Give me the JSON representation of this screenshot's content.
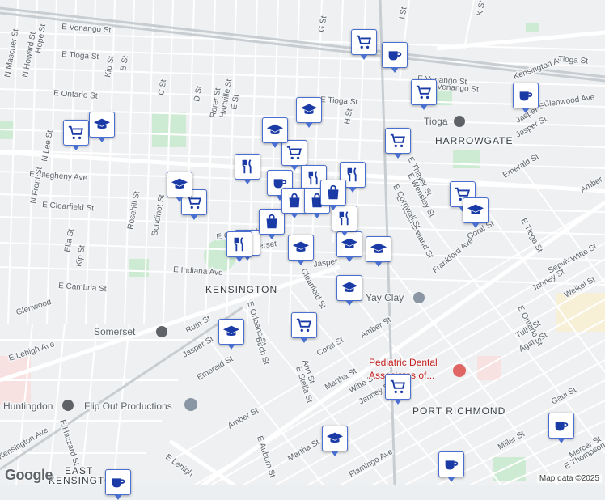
{
  "map": {
    "area_labels": [
      "HARROWGATE",
      "KENSINGTON",
      "PORT RICHMOND",
      "EAST",
      "KENSINGTON"
    ],
    "street_labels": [
      "E Venango St",
      "E Tioga St",
      "E Ontario St",
      "E Tioga St",
      "E Venango St",
      "Glenwood Ave",
      "Kensington Ave",
      "E Allegheny Ave",
      "E Clearfield St",
      "E Indiana Ave",
      "E Cambria St",
      "Ruth St",
      "Jasper St",
      "Emerald St",
      "E Lehigh Ave",
      "Amber St",
      "Coral St",
      "Martha St",
      "Witte St",
      "Janney St",
      "Agate St",
      "Tulip St",
      "Gaul St",
      "Miller St",
      "Mercer St",
      "E Thompson St",
      "Frankford Ave",
      "E Westmoreland St",
      "Sepviva St",
      "Witte St",
      "Janney St",
      "Weikel St",
      "Coral St",
      "Emerald St",
      "E Tioga St",
      "E Ontario St",
      "E Thayer St",
      "E Wensley St",
      "E Cornwall St",
      "Jasper St",
      "Amber",
      "N Mascher St",
      "N Howard St",
      "Hope St",
      "Kip St",
      "B St",
      "C St",
      "D St",
      "Rorer St",
      "Hartville St",
      "E St",
      "G St",
      "H St",
      "I St",
      "K St",
      "N Lee St",
      "N Front St",
      "Rosehill St",
      "Boudinot St",
      "Ella St",
      "Kip St",
      "E Orleans St",
      "Birch St",
      "Ann St",
      "E Stella St",
      "E Hazzard St",
      "E Auburn St",
      "Amber St",
      "Martha St",
      "Flamingo Ave",
      "E Lehigh",
      "Kensington Ave",
      "Clearfield St",
      "Jasper",
      "E Clearfield",
      "Venango St",
      "Tioga St",
      "Jasper St",
      "Somerset",
      "Glenwood"
    ],
    "poi_labels": [
      "Yay Clay",
      "Pediatric Dental",
      "Associates of...",
      "Flip Out Productions",
      "Somerset",
      "Huntingdon",
      "Tioga"
    ],
    "footer": {
      "logo": "Google",
      "attribution": "Map data ©2025"
    }
  }
}
